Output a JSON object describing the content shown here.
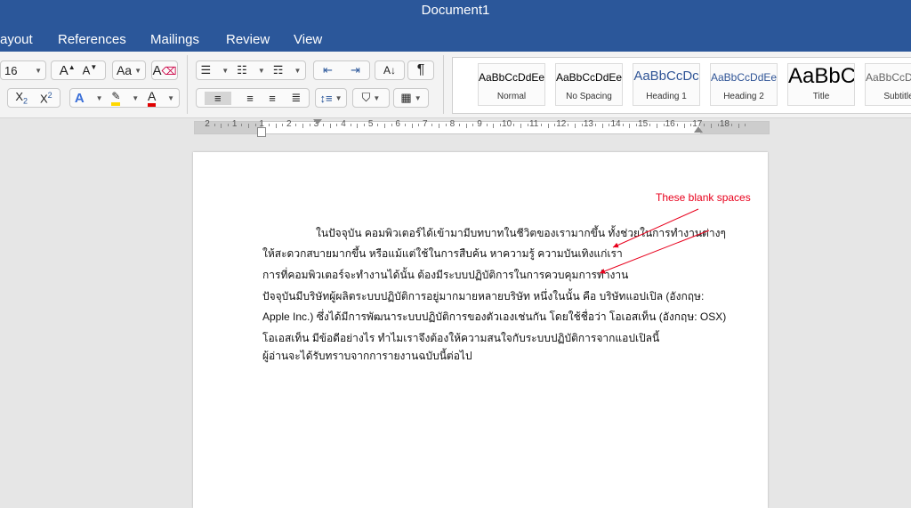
{
  "window": {
    "title": "Document1"
  },
  "tabs": [
    "ayout",
    "References",
    "Mailings",
    "Review",
    "View"
  ],
  "font": {
    "size": "16"
  },
  "styles": [
    {
      "preview": "AaBbCcDdEe",
      "name": "Normal"
    },
    {
      "preview": "AaBbCcDdEe",
      "name": "No Spacing"
    },
    {
      "preview": "AaBbCcDc",
      "name": "Heading 1"
    },
    {
      "preview": "AaBbCcDdEe",
      "name": "Heading 2"
    },
    {
      "preview": "AaBbC",
      "name": "Title"
    },
    {
      "preview": "AaBbCcDdEe",
      "name": "Subtitle"
    }
  ],
  "ruler": {
    "labels": [
      "2",
      "1",
      "1",
      "2",
      "3",
      "4",
      "5",
      "6",
      "7",
      "8",
      "9",
      "10",
      "11",
      "12",
      "13",
      "14",
      "15",
      "16",
      "17",
      "18"
    ]
  },
  "document": {
    "lines": [
      "ในปัจจุบัน คอมพิวเตอร์ได้เข้ามามีบทบาทในชีวิตของเรามากขึ้น ทั้งช่วยในการทำงานต่างๆ",
      "ให้สะดวกสบายมากขึ้น หรือแม้แต่ใช้ในการสืบค้น หาความรู้ ความบันเทิงแก่เรา",
      "การที่คอมพิวเตอร์จะทำงานได้นั้น ต้องมีระบบปฏิบัติการในการควบคุมการทำงาน",
      "ปัจจุบันมีบริษัทผู้ผลิตระบบปฏิบัติการอยู่มากมายหลายบริษัท หนึ่งในนั้น คือ บริษัทแอปเปิล (อังกฤษ:",
      "Apple Inc.) ซึ่งได้มีการพัฒนาระบบปฏิบัติการของตัวเองเช่นกัน โดยใช้ชื่อว่า โอเอสเท็น (อังกฤษ: OSX)",
      "โอเอสเท็น มีข้อดีอย่างไร ทำไมเราจึงต้องให้ความสนใจกับระบบปฏิบัติการจากแอปเปิลนี้",
      "ผู้อ่านจะได้รับทราบจากการายงานฉบับนี้ต่อไป"
    ]
  },
  "annotation": {
    "text": "These blank spaces",
    "color": "#e8001c"
  },
  "colors": {
    "titlebar": "#2b579a",
    "highlight": "#ffd800",
    "font_color": "#e00000"
  },
  "icons": [
    "grow-font-icon",
    "shrink-font-icon",
    "change-case-icon",
    "clear-formatting-icon",
    "subscript-icon",
    "superscript-icon",
    "text-effects-icon",
    "highlight-icon",
    "font-color-icon",
    "bullets-icon",
    "numbering-icon",
    "multilevel-list-icon",
    "decrease-indent-icon",
    "increase-indent-icon",
    "sort-icon",
    "pilcrow-icon",
    "align-left-icon",
    "align-center-icon",
    "align-right-icon",
    "justify-icon",
    "line-spacing-icon",
    "shading-icon",
    "borders-icon"
  ]
}
